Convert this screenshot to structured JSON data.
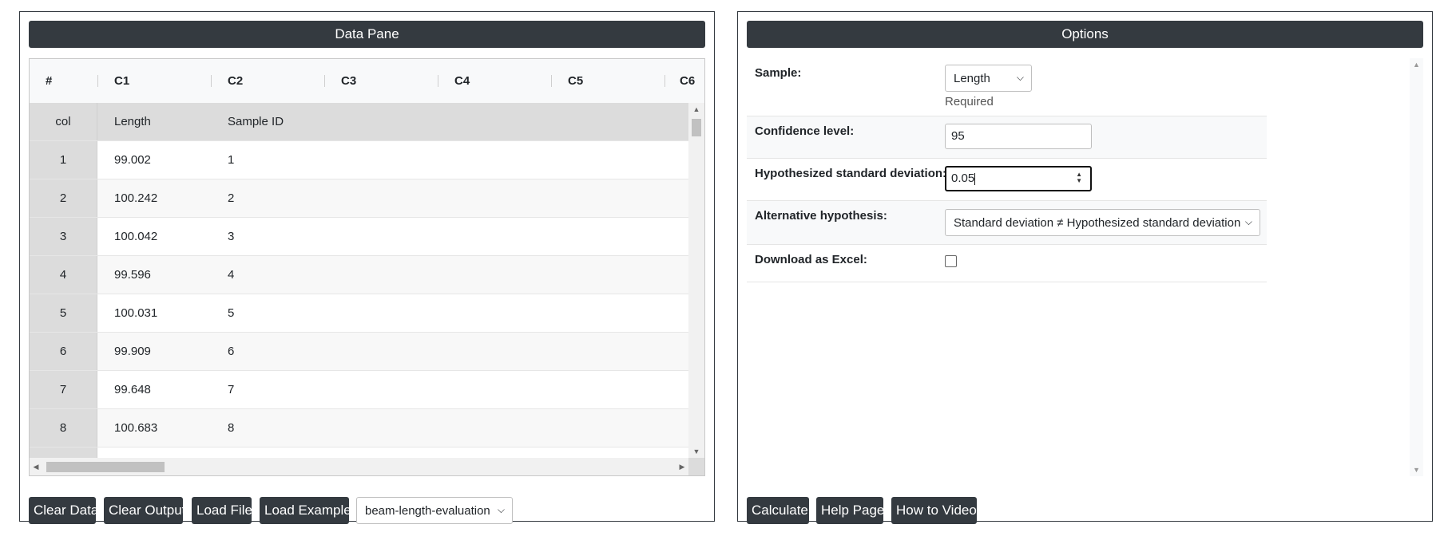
{
  "data_pane": {
    "title": "Data Pane",
    "columns": [
      "#",
      "C1",
      "C2",
      "C3",
      "C4",
      "C5",
      "C6"
    ],
    "label_row": {
      "index": "col",
      "c1": "Length",
      "c2": "Sample ID"
    },
    "rows": [
      {
        "index": "1",
        "c1": "99.002",
        "c2": "1"
      },
      {
        "index": "2",
        "c1": "100.242",
        "c2": "2"
      },
      {
        "index": "3",
        "c1": "100.042",
        "c2": "3"
      },
      {
        "index": "4",
        "c1": "99.596",
        "c2": "4"
      },
      {
        "index": "5",
        "c1": "100.031",
        "c2": "5"
      },
      {
        "index": "6",
        "c1": "99.909",
        "c2": "6"
      },
      {
        "index": "7",
        "c1": "99.648",
        "c2": "7"
      },
      {
        "index": "8",
        "c1": "100.683",
        "c2": "8"
      }
    ],
    "buttons": {
      "clear_data": "Clear Data",
      "clear_output": "Clear Output",
      "load_file": "Load File",
      "load_example": "Load Example"
    },
    "example_select": "beam-length-evaluation"
  },
  "options": {
    "title": "Options",
    "sample": {
      "label": "Sample:",
      "value": "Length",
      "help": "Required"
    },
    "confidence": {
      "label": "Confidence level:",
      "value": "95"
    },
    "hyp_sd": {
      "label": "Hypothesized standard deviation:",
      "value": "0.05"
    },
    "alternative": {
      "label": "Alternative hypothesis:",
      "value": "Standard deviation ≠ Hypothesized standard deviation"
    },
    "download": {
      "label": "Download as Excel:",
      "checked": false
    },
    "buttons": {
      "calculate": "Calculate",
      "help": "Help Page",
      "video": "How to Video"
    }
  }
}
